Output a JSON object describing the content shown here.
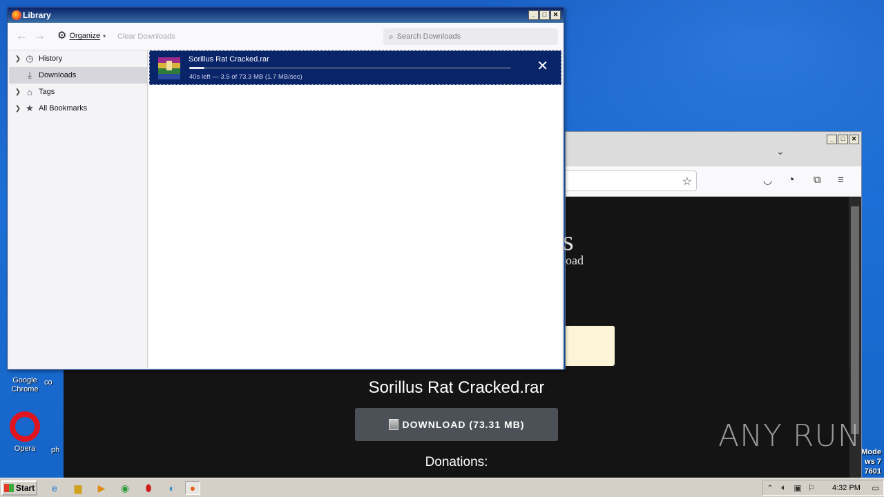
{
  "library": {
    "title": "Library",
    "organize_label": "Organize",
    "clear_downloads_label": "Clear Downloads",
    "search_placeholder": "Search Downloads",
    "sidebar": [
      {
        "label": "History",
        "icon": "clock-icon",
        "expandable": true
      },
      {
        "label": "Downloads",
        "icon": "download-icon",
        "expandable": false,
        "selected": true
      },
      {
        "label": "Tags",
        "icon": "tag-icon",
        "expandable": true
      },
      {
        "label": "All Bookmarks",
        "icon": "star-icon",
        "expandable": true
      }
    ],
    "download": {
      "filename": "Sorillus Rat Cracked.rar",
      "status": "40s left — 3.5 of 73.3 MB (1.7 MB/sec)",
      "progress_fraction": 0.048
    }
  },
  "page": {
    "filename": "Sorillus Rat Cracked.rar",
    "download_button": "DOWNLOAD (73.31 MB)",
    "donations": "Donations:",
    "partial_heading": "s",
    "partial_sub": "oad"
  },
  "desktop": {
    "icons": [
      {
        "label": "Google\nChrome"
      },
      {
        "label": "Opera"
      }
    ],
    "partial_labels": [
      "co",
      "ph"
    ],
    "edge_text": "Mode\nws 7\n7601",
    "watermark": "ANY RUN"
  },
  "taskbar": {
    "start_label": "Start",
    "clock": "4:32 PM"
  },
  "colors": {
    "selection": "#0a246a",
    "titlebar": "#0a246a",
    "page_bg": "#141414",
    "button": "#4b5157"
  }
}
